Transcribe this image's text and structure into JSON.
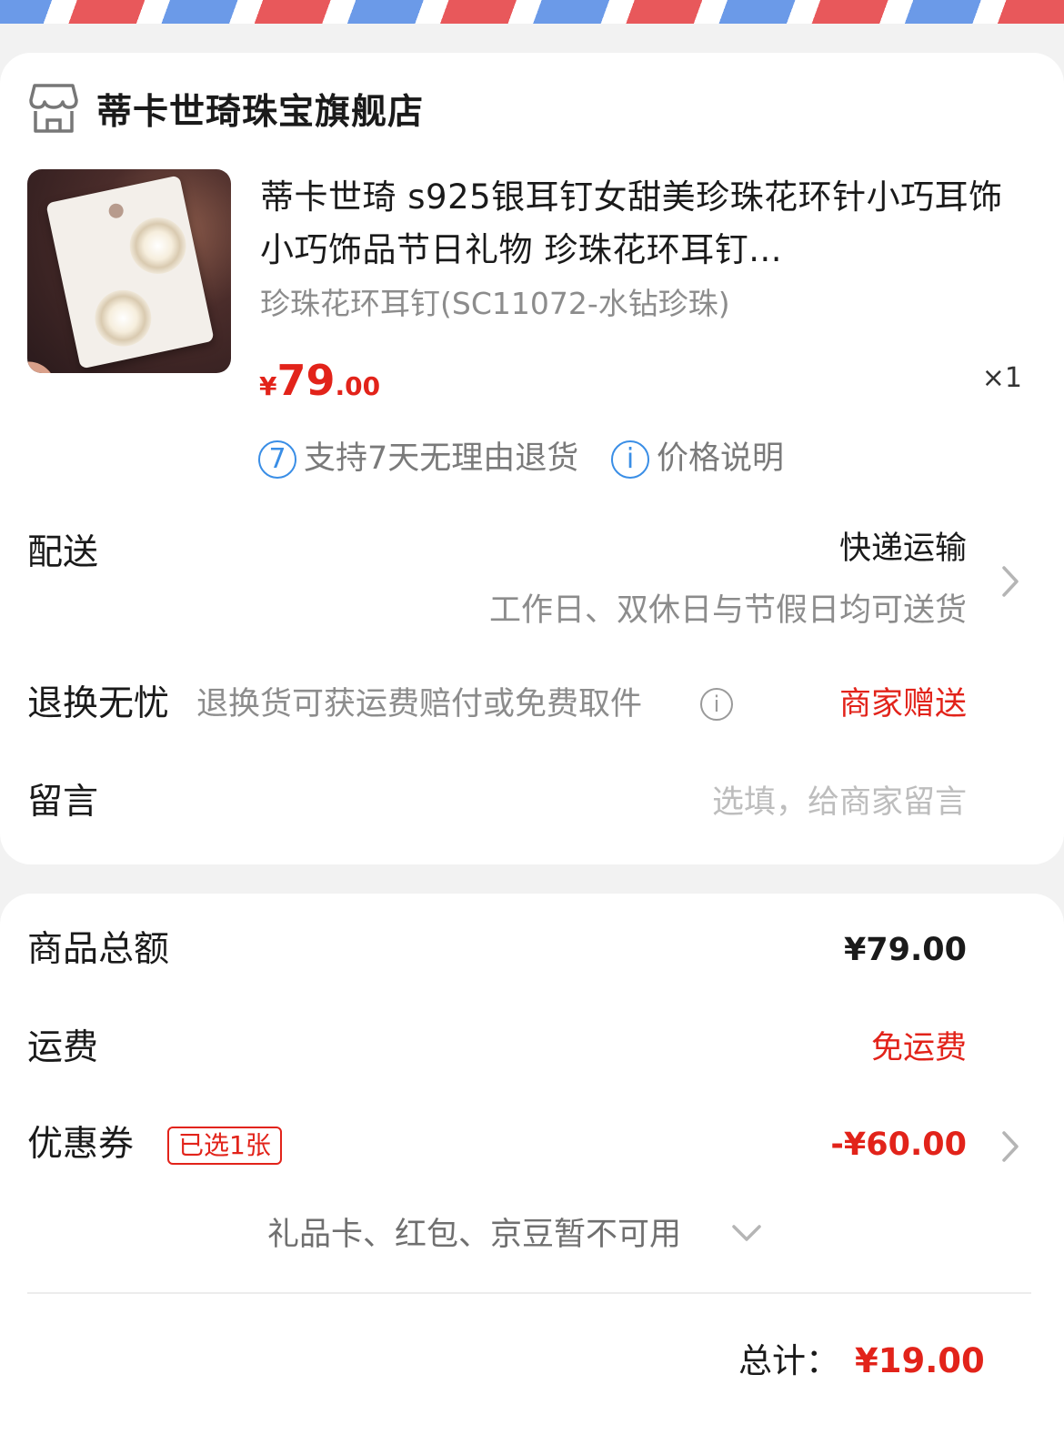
{
  "colors": {
    "accent": "#e2231a",
    "link_blue": "#3a8ee6",
    "background": "#f2f2f2"
  },
  "shop": {
    "icon": "store-icon",
    "name": "蒂卡世琦珠宝旗舰店"
  },
  "product": {
    "title": "蒂卡世琦 s925银耳钉女甜美珍珠花环针小巧耳饰小巧饰品节日礼物 珍珠花环耳钉...",
    "sku": "珍珠花环耳钉(SC11072-水钻珍珠)",
    "price_currency": "¥",
    "price_int": "79",
    "price_dec": ".00",
    "quantity": "×1",
    "services": [
      {
        "icon": "seven-day-return-icon",
        "icon_text": "7",
        "label": "支持7天无理由退货"
      },
      {
        "icon": "info-icon",
        "icon_text": "i",
        "label": "价格说明"
      }
    ]
  },
  "delivery": {
    "label": "配送",
    "method": "快递运输",
    "note": "工作日、双休日与节假日均可送货"
  },
  "return_insurance": {
    "label": "退换无忧",
    "desc": "退换货可获运费赔付或免费取件",
    "value": "商家赠送"
  },
  "message": {
    "label": "留言",
    "placeholder": "选填，给商家留言"
  },
  "summary": {
    "goods_total_label": "商品总额",
    "goods_total_value": "¥79.00",
    "shipping_label": "运费",
    "shipping_value": "免运费",
    "coupon_label": "优惠券",
    "coupon_badge": "已选1张",
    "coupon_value": "-¥60.00",
    "unavailable_note": "礼品卡、红包、京豆暂不可用",
    "total_label": "总计：",
    "total_value": "¥19.00"
  }
}
